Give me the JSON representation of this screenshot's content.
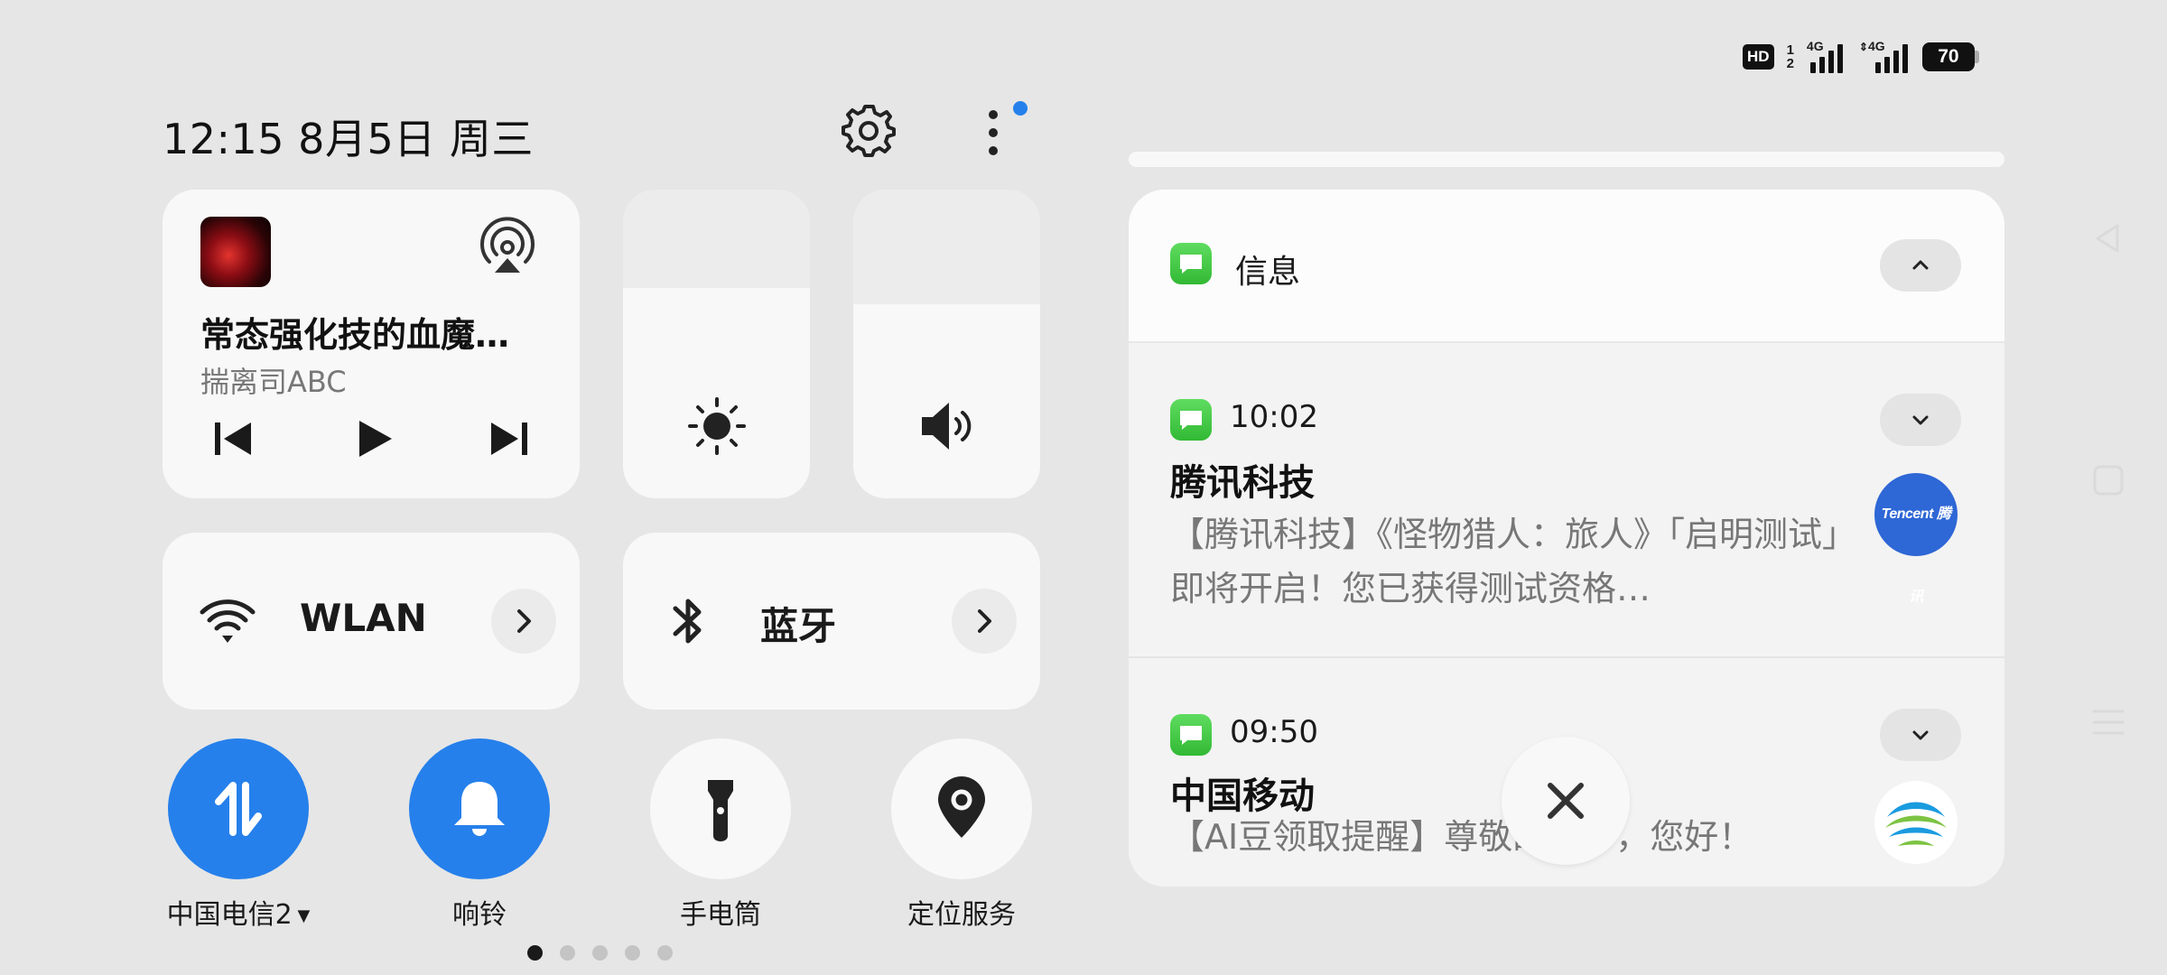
{
  "status_bar": {
    "hd": "HD",
    "sim_index": [
      "1",
      "2"
    ],
    "network1": "4G",
    "network2": "4G",
    "battery_level": "70",
    "battery_fraction": 0.7
  },
  "header": {
    "datetime": "12:15 8月5日 周三",
    "settings_icon": "gear-icon",
    "more_icon": "more-vertical-icon",
    "more_badge_color": "#2680eb"
  },
  "media": {
    "title": "常态强化技的血魔…",
    "artist": "揣离司ABC",
    "controls": [
      "previous-icon",
      "play-icon",
      "next-icon"
    ],
    "cast_icon": "cast-icon"
  },
  "sliders": {
    "brightness_level": 0.68,
    "volume_level": 0.63,
    "brightness_icon": "sun-icon",
    "volume_icon": "speaker-icon"
  },
  "tiles": {
    "wlan": {
      "label": "WLAN",
      "icon": "wifi-icon"
    },
    "bluetooth": {
      "label": "蓝牙",
      "icon": "bluetooth-icon"
    }
  },
  "toggles": [
    {
      "label": "中国电信2",
      "on": true,
      "icon": "mobile-data-icon",
      "has_dropdown": true
    },
    {
      "label": "响铃",
      "on": true,
      "icon": "bell-icon"
    },
    {
      "label": "手电筒",
      "on": false,
      "icon": "flashlight-icon"
    },
    {
      "label": "定位服务",
      "on": false,
      "icon": "location-icon"
    }
  ],
  "pager": {
    "count": 5,
    "active": 0
  },
  "notifications": {
    "app_name": "信息",
    "items": [
      {
        "time": "10:02",
        "sender": "腾讯科技",
        "body": "【腾讯科技】《怪物猎人：旅人》「启明测试」即将开启！您已获得测试资格…",
        "avatar_text": "Tencent 腾讯"
      },
      {
        "time": "09:50",
        "sender": "中国移动",
        "body": "【AI豆领取提醒】尊敬的客户，您好！"
      }
    ]
  },
  "colors": {
    "accent": "#2680eb",
    "background": "#e6e6e6",
    "card": "#f8f8f8",
    "message_green": "#43c845"
  }
}
